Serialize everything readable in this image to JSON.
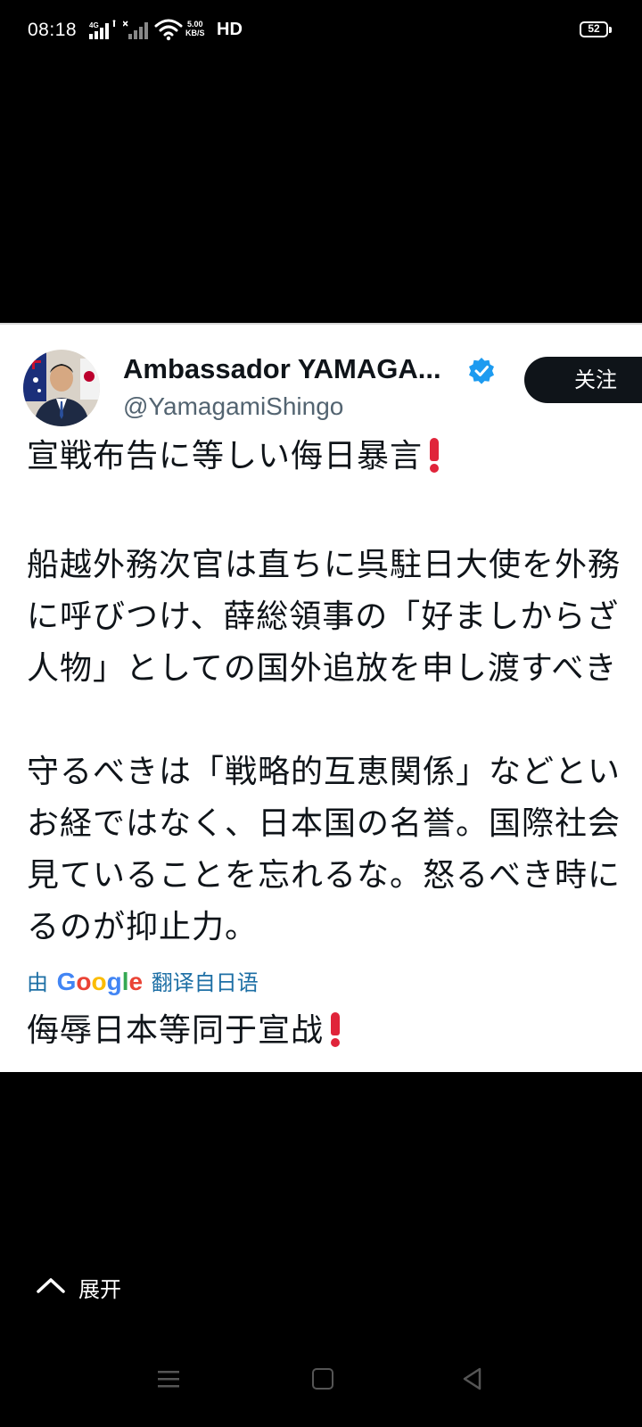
{
  "status_bar": {
    "time": "08:18",
    "network": "4G",
    "speed_value": "5.00",
    "speed_unit": "KB/S",
    "hd": "HD",
    "battery": "52"
  },
  "tweet": {
    "display_name": "Ambassador YAMAGA...",
    "handle": "@YamagamiShingo",
    "follow_label": "关注",
    "lines": {
      "l1": "宣戦布告に等しい侮日暴言",
      "p2_l1": "船越外務次官は直ちに呉駐日大使を外務",
      "p2_l2": "に呼びつけ、薛総領事の「好ましからざ",
      "p2_l3": "人物」としての国外追放を申し渡すべき",
      "p3_l1": "守るべきは「戦略的互恵関係」などとい",
      "p3_l2": "お経ではなく、日本国の名誉。国際社会",
      "p3_l3": "見ていることを忘れるな。怒るべき時に",
      "p3_l4": "るのが抑止力。"
    },
    "translation": {
      "by": "由",
      "provider": "Google",
      "from": "翻译自日语",
      "text": "侮辱日本等同于宣战"
    }
  },
  "expand_label": "展开",
  "colors": {
    "text": "#0f1419",
    "secondary": "#536471",
    "verified": "#1d9bf0",
    "accent_link": "#1d6fa5",
    "exclamation": "#e0243a"
  }
}
